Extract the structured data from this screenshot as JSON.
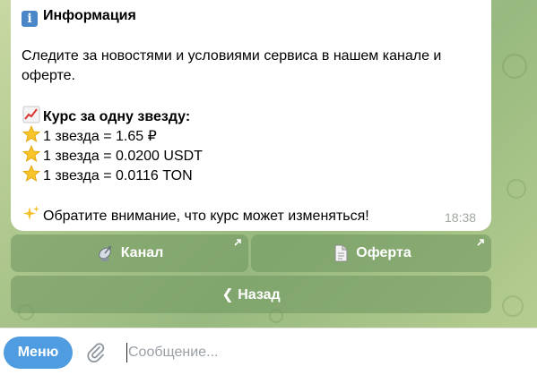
{
  "message": {
    "title": "Информация",
    "line1": "Следите за новостями и условиями сервиса в нашем канале и",
    "line2": "оферте.",
    "rates_heading": "Курс за одну звезду:",
    "rates": [
      "1 звезда = 1.65 ₽",
      "1 звезда = 0.0200 USDT",
      "1 звезда = 0.0116 TON"
    ],
    "notice": "Обратите внимание, что курс может изменяться!",
    "time": "18:38"
  },
  "keyboard": {
    "channel_label": "Канал",
    "offer_label": "Оферта",
    "back_label": "❮ Назад"
  },
  "composer": {
    "menu_label": "Меню",
    "placeholder": "Сообщение..."
  },
  "icons": {
    "title": "info-icon",
    "rates": "chart-increasing-icon",
    "rate_rows": "star-icon",
    "notice": "sparkles-icon",
    "channel": "satellite-antenna-icon",
    "offer": "document-icon",
    "attach": "paperclip-icon"
  },
  "colors": {
    "menu_button": "#4f9de0",
    "chat_background": "#a9c48a",
    "keyboard_button": "#7e9e6a"
  }
}
